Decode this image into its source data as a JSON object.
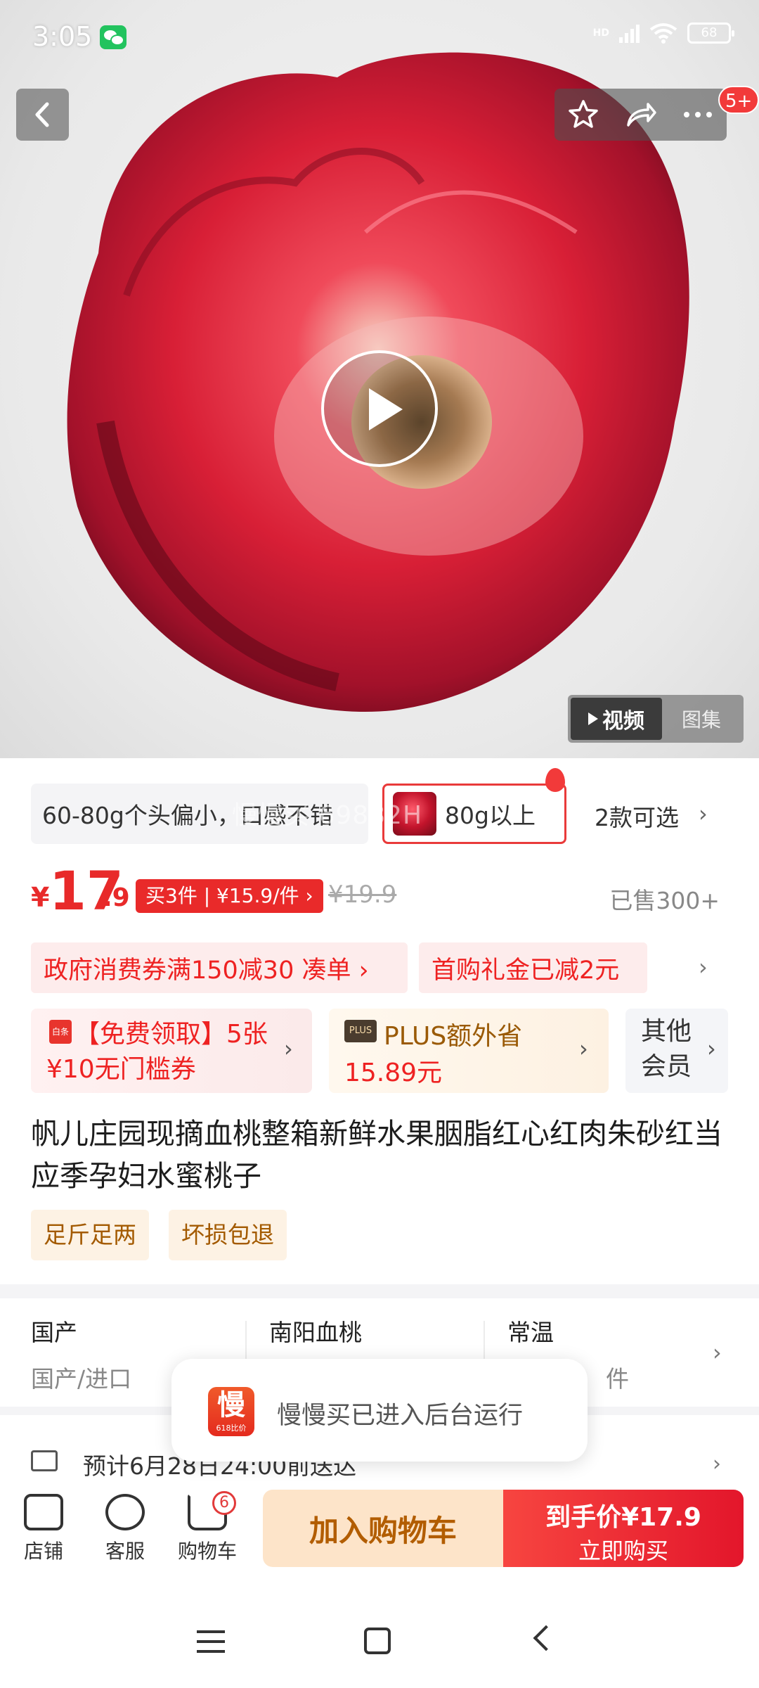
{
  "status_bar": {
    "time": "3:05",
    "network": "HD",
    "battery": "68"
  },
  "header": {
    "cart_count_badge": "5+"
  },
  "media": {
    "video_tab": "视频",
    "gallery_tab": "图集"
  },
  "variants": {
    "option_1": "60-80g个头偏小，口感不错",
    "option_2": "80g以上",
    "count_label": "2款可选",
    "watermark": "慢慢买 69882H"
  },
  "price": {
    "currency": "¥",
    "integer": "17",
    "decimal": ".9",
    "multi_buy": "买3件 | ¥15.9/件 ›",
    "original": "¥19.9",
    "sold": "已售300+"
  },
  "coupons": {
    "gov": "政府消费券满150减30  凑单 ›",
    "first": "首购礼金已减2元"
  },
  "benefits": {
    "free_icon": "白条",
    "free_text": "【免费领取】5张¥10无门槛券",
    "plus_badge": "PLUS",
    "plus_text": "PLUS额外省",
    "plus_amount": "15.89元",
    "other": "其他会员"
  },
  "product": {
    "title": "帆儿庄园现摘血桃整箱新鲜水果胭脂红心红肉朱砂红当应季孕妇水蜜桃子",
    "tags": [
      "足斤足两",
      "坏损包退"
    ]
  },
  "specs": [
    {
      "value": "国产",
      "key": "国产/进口"
    },
    {
      "value": "南阳血桃",
      "key": ""
    },
    {
      "value": "常温",
      "key": "件"
    }
  ],
  "delivery": {
    "text": "预计6月28日24:00前送达"
  },
  "toast": {
    "icon_glyph": "慢",
    "icon_sub": "618比价",
    "text": "慢慢买已进入后台运行"
  },
  "bottom_nav": {
    "store": "店铺",
    "service": "客服",
    "cart": "购物车",
    "cart_badge": "6",
    "add_to_cart": "加入购物车",
    "buy_line1": "到手价¥17.9",
    "buy_line2": "立即购买"
  }
}
